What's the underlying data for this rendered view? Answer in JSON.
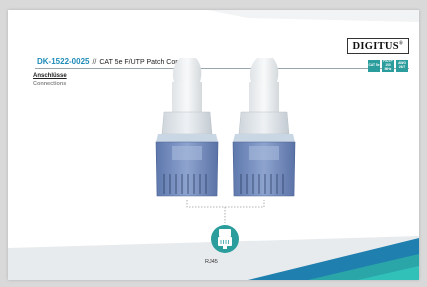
{
  "brand": {
    "logo_text": "DIGITUS",
    "logo_mark": "®"
  },
  "header": {
    "product_code": "DK-1522-0025",
    "separator": "//",
    "product_name": "CAT 5e F/UTP Patch Cord"
  },
  "section": {
    "title_de": "Anschlüsse",
    "title_en": "Connections"
  },
  "badges": [
    {
      "label": "CAT 5e"
    },
    {
      "label": "F/UTP 100 MHz"
    },
    {
      "label": "AWG 26/7"
    }
  ],
  "connector": {
    "label": "RJ45",
    "icon": "rj45-plug-icon"
  },
  "colors": {
    "accent": "#1e8bb8",
    "badge": "#2a9d9c",
    "connector_blue": "#6d86b8",
    "cable_white": "#eef1f3"
  }
}
